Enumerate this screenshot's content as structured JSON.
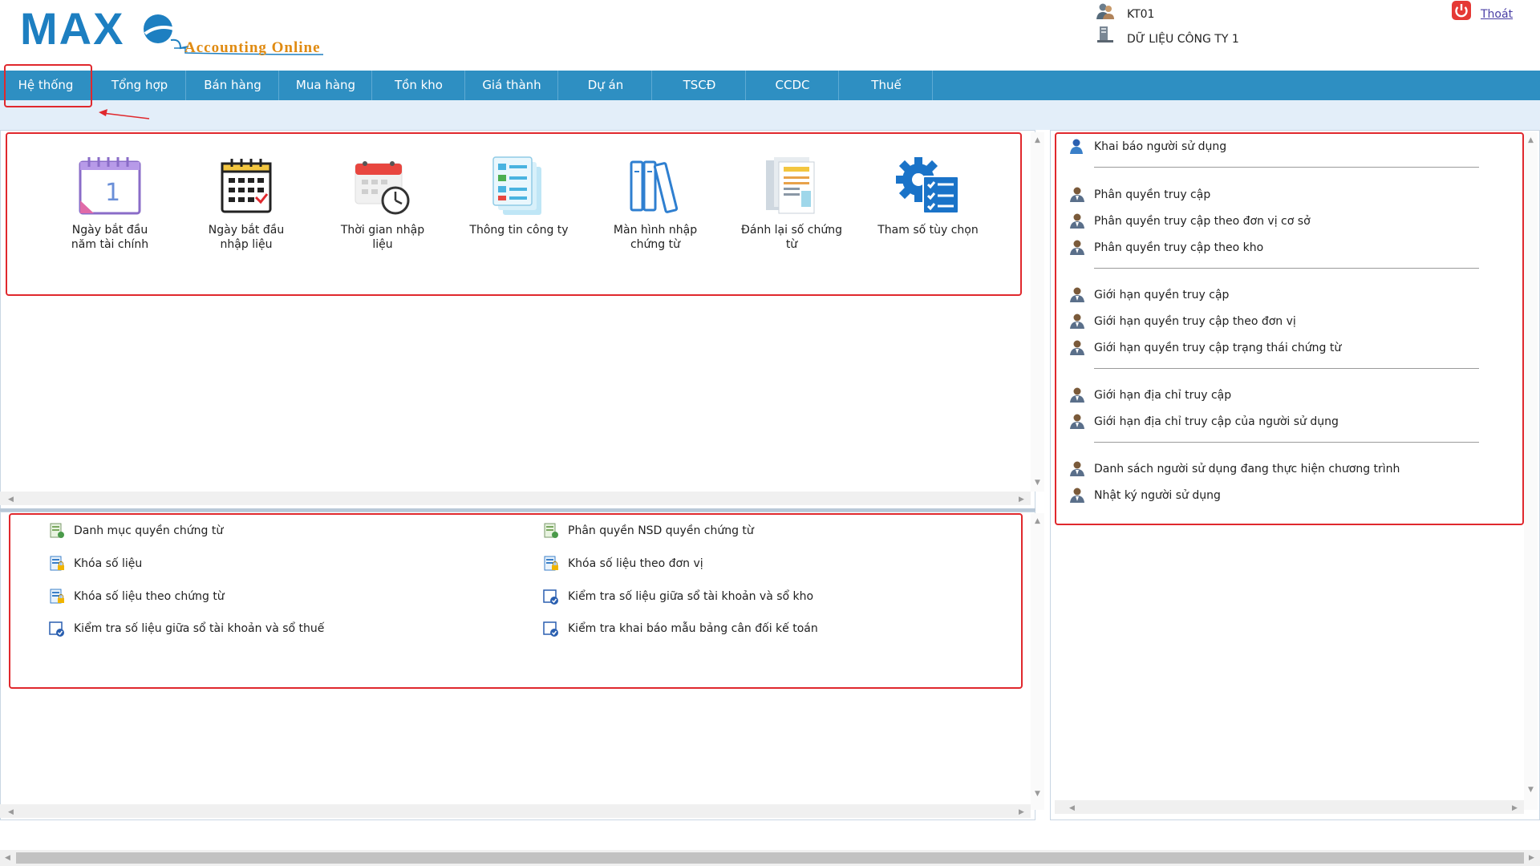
{
  "header": {
    "brand": "MAX",
    "brand_sub": "Accounting Online",
    "user": "KT01",
    "company": "DỮ LIỆU CÔNG TY 1",
    "logout": "Thoát",
    "colors": {
      "brand_blue": "#1d7fc1",
      "brand_orange": "#e08b12",
      "menu_bar": "#2e8fc2",
      "highlight_red": "#e0282d"
    }
  },
  "menu": [
    {
      "label": "Hệ thống"
    },
    {
      "label": "Tổng hợp"
    },
    {
      "label": "Bán hàng"
    },
    {
      "label": "Mua hàng"
    },
    {
      "label": "Tồn kho"
    },
    {
      "label": "Giá thành"
    },
    {
      "label": "Dự án"
    },
    {
      "label": "TSCĐ"
    },
    {
      "label": "CCDC"
    },
    {
      "label": "Thuế"
    }
  ],
  "tiles": [
    {
      "line1": "Ngày bắt đầu",
      "line2": "năm tài chính",
      "icon": "calendar-one-icon"
    },
    {
      "line1": "Ngày bắt đầu",
      "line2": "nhập liệu",
      "icon": "calendar-grid-icon"
    },
    {
      "line1": "Thời gian nhập",
      "line2": "liệu",
      "icon": "calendar-clock-icon"
    },
    {
      "line1": "Thông tin công ty",
      "line2": "",
      "icon": "document-list-icon"
    },
    {
      "line1": "Màn hình nhập",
      "line2": "chứng từ",
      "icon": "binders-icon"
    },
    {
      "line1": "Đánh lại số chứng",
      "line2": "từ",
      "icon": "papers-icon"
    },
    {
      "line1": "Tham số tùy chọn",
      "line2": "",
      "icon": "gear-checklist-icon"
    }
  ],
  "lower_links": {
    "left": [
      {
        "label": "Danh mục quyền chứng từ",
        "icon": "doc-settings-icon"
      },
      {
        "label": "Khóa số liệu",
        "icon": "doc-lock-icon"
      },
      {
        "label": "Khóa số liệu theo chứng từ",
        "icon": "doc-lock-icon"
      },
      {
        "label": "Kiểm tra số liệu giữa sổ tài khoản và sổ thuế",
        "icon": "doc-check-icon"
      }
    ],
    "right": [
      {
        "label": "Phân quyền NSD quyền chứng từ",
        "icon": "doc-settings-icon"
      },
      {
        "label": "Khóa số liệu theo đơn vị",
        "icon": "doc-lock-icon"
      },
      {
        "label": "Kiểm tra số liệu giữa sổ tài khoản và sổ kho",
        "icon": "doc-check-icon"
      },
      {
        "label": "Kiểm tra khai báo mẫu bảng cân đối kế toán",
        "icon": "doc-check-icon"
      }
    ]
  },
  "user_links": [
    {
      "label": "Khai báo người sử dụng"
    },
    {
      "label": "Phân quyền truy cập"
    },
    {
      "label": "Phân quyền truy cập theo đơn vị cơ sở"
    },
    {
      "label": "Phân quyền truy cập theo kho"
    },
    {
      "label": "Giới hạn quyền truy cập"
    },
    {
      "label": "Giới hạn quyền truy cập theo đơn vị"
    },
    {
      "label": "Giới hạn quyền truy cập trạng thái chứng từ"
    },
    {
      "label": "Giới hạn địa chỉ truy cập"
    },
    {
      "label": "Giới hạn địa chỉ truy cập của người sử dụng"
    },
    {
      "label": "Danh sách người sử dụng đang thực hiện chương trình"
    },
    {
      "label": "Nhật ký người sử dụng"
    }
  ]
}
